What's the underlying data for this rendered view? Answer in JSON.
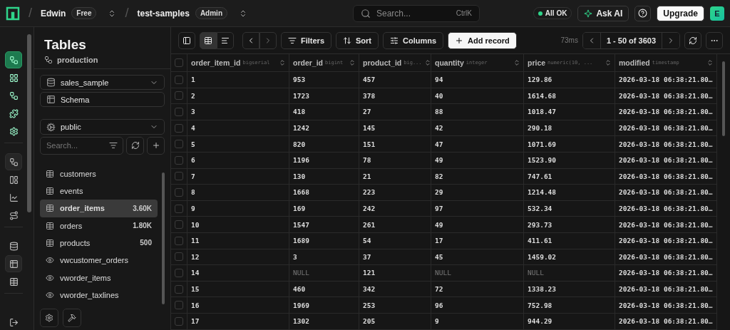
{
  "top_bar": {
    "separators": [
      "/",
      "/"
    ],
    "org": {
      "name": "Edwin",
      "plan": "Free"
    },
    "project": {
      "name": "test-samples",
      "role": "Admin"
    },
    "search": {
      "placeholder": "Search...",
      "shortcut": "CtrlK"
    },
    "status": {
      "text": "All OK",
      "ok": true
    },
    "ask_ai": "Ask AI",
    "upgrade": "Upgrade",
    "avatar": "E"
  },
  "rail_groups": [
    [
      {
        "selected": true
      },
      {
        "selected": false
      },
      {
        "selected": false
      },
      {
        "selected": false
      },
      {
        "selected": false
      }
    ],
    [
      {
        "selected": true
      },
      {
        "selected": false
      },
      {
        "selected": false
      },
      {
        "selected": false
      }
    ],
    [
      {
        "selected": false
      },
      {
        "selected": true
      },
      {
        "selected": false
      }
    ]
  ],
  "sidebar": {
    "title": "Tables",
    "schema_name": "production",
    "database": "sales_sample",
    "schema_button": "Schema",
    "namespace": "public",
    "search": {
      "placeholder": "Search..."
    },
    "tables": [
      {
        "name": "customers",
        "kind": "table",
        "selected": false
      },
      {
        "name": "events",
        "kind": "table",
        "selected": false
      },
      {
        "name": "order_items",
        "kind": "table",
        "count": "3.60K",
        "selected": true
      },
      {
        "name": "orders",
        "kind": "table",
        "count": "1.80K",
        "selected": false
      },
      {
        "name": "products",
        "kind": "table",
        "count": "500",
        "selected": false
      },
      {
        "name": "vwcustomer_orders",
        "kind": "view",
        "selected": false
      },
      {
        "name": "vworder_items",
        "kind": "view",
        "selected": false
      },
      {
        "name": "vworder_taxlines",
        "kind": "view",
        "selected": false
      }
    ]
  },
  "toolbar": {
    "view_modes": [
      {
        "selected": true
      },
      {
        "selected": false
      }
    ],
    "filters": "Filters",
    "sort": "Sort",
    "columns": "Columns",
    "add_record": "Add record",
    "timing": "73ms",
    "pagination": "1 - 50 of 3603"
  },
  "table": {
    "all_checked": false,
    "columns": [
      {
        "name": "order_item_id",
        "type": "bigserial"
      },
      {
        "name": "order_id",
        "type": "bigint"
      },
      {
        "name": "product_id",
        "type": "big..."
      },
      {
        "name": "quantity",
        "type": "integer"
      },
      {
        "name": "price",
        "type": "numeric(10, ..."
      },
      {
        "name": "modified",
        "type": "timestamp"
      }
    ],
    "rows": [
      {
        "checked": false,
        "cells": [
          "1",
          "953",
          "457",
          "94",
          "129.86",
          "2026-03-18 06:38:21.80…"
        ]
      },
      {
        "checked": false,
        "cells": [
          "2",
          "1723",
          "378",
          "40",
          "1614.68",
          "2026-03-18 06:38:21.80…"
        ]
      },
      {
        "checked": false,
        "cells": [
          "3",
          "418",
          "27",
          "88",
          "1018.47",
          "2026-03-18 06:38:21.80…"
        ]
      },
      {
        "checked": false,
        "cells": [
          "4",
          "1242",
          "145",
          "42",
          "290.18",
          "2026-03-18 06:38:21.80…"
        ]
      },
      {
        "checked": false,
        "cells": [
          "5",
          "820",
          "151",
          "47",
          "1071.69",
          "2026-03-18 06:38:21.80…"
        ]
      },
      {
        "checked": false,
        "cells": [
          "6",
          "1196",
          "78",
          "49",
          "1523.90",
          "2026-03-18 06:38:21.80…"
        ]
      },
      {
        "checked": false,
        "cells": [
          "7",
          "130",
          "21",
          "82",
          "747.61",
          "2026-03-18 06:38:21.80…"
        ]
      },
      {
        "checked": false,
        "cells": [
          "8",
          "1668",
          "223",
          "29",
          "1214.48",
          "2026-03-18 06:38:21.80…"
        ]
      },
      {
        "checked": false,
        "cells": [
          "9",
          "169",
          "242",
          "97",
          "532.34",
          "2026-03-18 06:38:21.80…"
        ]
      },
      {
        "checked": false,
        "cells": [
          "10",
          "1547",
          "261",
          "49",
          "293.73",
          "2026-03-18 06:38:21.80…"
        ]
      },
      {
        "checked": false,
        "cells": [
          "11",
          "1689",
          "54",
          "17",
          "411.61",
          "2026-03-18 06:38:21.80…"
        ]
      },
      {
        "checked": false,
        "cells": [
          "12",
          "3",
          "37",
          "45",
          "1459.02",
          "2026-03-18 06:38:21.80…"
        ]
      },
      {
        "checked": false,
        "cells": [
          "14",
          {
            "text": "NULL",
            "kind": "null"
          },
          "121",
          {
            "text": "NULL",
            "kind": "null"
          },
          {
            "text": "NULL",
            "kind": "null"
          },
          "2026-03-18 06:38:21.80…"
        ]
      },
      {
        "checked": false,
        "cells": [
          "15",
          "460",
          "342",
          "72",
          "1338.23",
          "2026-03-18 06:38:21.80…"
        ]
      },
      {
        "checked": false,
        "cells": [
          "16",
          "1969",
          "253",
          "96",
          "752.98",
          "2026-03-18 06:38:21.80…"
        ]
      },
      {
        "checked": false,
        "cells": [
          "17",
          "1302",
          "205",
          "9",
          "944.29",
          "2026-03-18 06:38:21.80…"
        ]
      }
    ]
  }
}
